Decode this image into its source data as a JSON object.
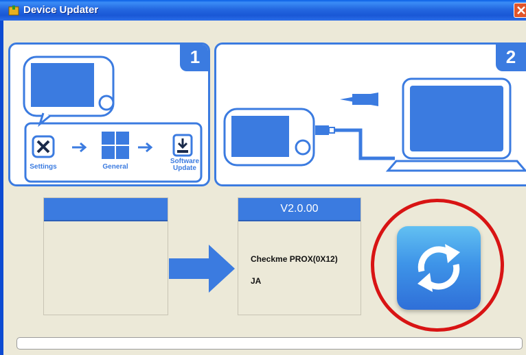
{
  "window": {
    "title": "Device Updater"
  },
  "steps": [
    {
      "number": "1",
      "labels": {
        "settings": "Settings",
        "general": "General",
        "software_update": "Software\nUpdate"
      }
    },
    {
      "number": "2"
    }
  ],
  "device_info": {
    "left_header": "",
    "version": "V2.0.00",
    "model": "Checkme PROX(0X12)",
    "language": "JA"
  },
  "icons": {
    "app": "app-icon",
    "close": "close-icon",
    "settings": "settings-icon",
    "general": "general-icon",
    "software_update": "software-update-icon",
    "arrow": "arrow-right-icon",
    "update": "sync-icon"
  },
  "progress": {
    "value": 0
  },
  "colors": {
    "accent": "#3b7be0",
    "highlight": "#d81414",
    "titlebar": "#2468e0"
  }
}
